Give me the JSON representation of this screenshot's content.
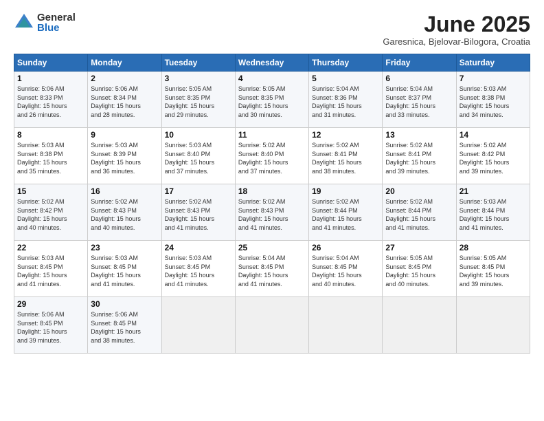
{
  "header": {
    "logo_general": "General",
    "logo_blue": "Blue",
    "month_title": "June 2025",
    "location": "Garesnica, Bjelovar-Bilogora, Croatia"
  },
  "weekdays": [
    "Sunday",
    "Monday",
    "Tuesday",
    "Wednesday",
    "Thursday",
    "Friday",
    "Saturday"
  ],
  "weeks": [
    [
      {
        "day": "1",
        "info": "Sunrise: 5:06 AM\nSunset: 8:33 PM\nDaylight: 15 hours\nand 26 minutes."
      },
      {
        "day": "2",
        "info": "Sunrise: 5:06 AM\nSunset: 8:34 PM\nDaylight: 15 hours\nand 28 minutes."
      },
      {
        "day": "3",
        "info": "Sunrise: 5:05 AM\nSunset: 8:35 PM\nDaylight: 15 hours\nand 29 minutes."
      },
      {
        "day": "4",
        "info": "Sunrise: 5:05 AM\nSunset: 8:35 PM\nDaylight: 15 hours\nand 30 minutes."
      },
      {
        "day": "5",
        "info": "Sunrise: 5:04 AM\nSunset: 8:36 PM\nDaylight: 15 hours\nand 31 minutes."
      },
      {
        "day": "6",
        "info": "Sunrise: 5:04 AM\nSunset: 8:37 PM\nDaylight: 15 hours\nand 33 minutes."
      },
      {
        "day": "7",
        "info": "Sunrise: 5:03 AM\nSunset: 8:38 PM\nDaylight: 15 hours\nand 34 minutes."
      }
    ],
    [
      {
        "day": "8",
        "info": "Sunrise: 5:03 AM\nSunset: 8:38 PM\nDaylight: 15 hours\nand 35 minutes."
      },
      {
        "day": "9",
        "info": "Sunrise: 5:03 AM\nSunset: 8:39 PM\nDaylight: 15 hours\nand 36 minutes."
      },
      {
        "day": "10",
        "info": "Sunrise: 5:03 AM\nSunset: 8:40 PM\nDaylight: 15 hours\nand 37 minutes."
      },
      {
        "day": "11",
        "info": "Sunrise: 5:02 AM\nSunset: 8:40 PM\nDaylight: 15 hours\nand 37 minutes."
      },
      {
        "day": "12",
        "info": "Sunrise: 5:02 AM\nSunset: 8:41 PM\nDaylight: 15 hours\nand 38 minutes."
      },
      {
        "day": "13",
        "info": "Sunrise: 5:02 AM\nSunset: 8:41 PM\nDaylight: 15 hours\nand 39 minutes."
      },
      {
        "day": "14",
        "info": "Sunrise: 5:02 AM\nSunset: 8:42 PM\nDaylight: 15 hours\nand 39 minutes."
      }
    ],
    [
      {
        "day": "15",
        "info": "Sunrise: 5:02 AM\nSunset: 8:42 PM\nDaylight: 15 hours\nand 40 minutes."
      },
      {
        "day": "16",
        "info": "Sunrise: 5:02 AM\nSunset: 8:43 PM\nDaylight: 15 hours\nand 40 minutes."
      },
      {
        "day": "17",
        "info": "Sunrise: 5:02 AM\nSunset: 8:43 PM\nDaylight: 15 hours\nand 41 minutes."
      },
      {
        "day": "18",
        "info": "Sunrise: 5:02 AM\nSunset: 8:43 PM\nDaylight: 15 hours\nand 41 minutes."
      },
      {
        "day": "19",
        "info": "Sunrise: 5:02 AM\nSunset: 8:44 PM\nDaylight: 15 hours\nand 41 minutes."
      },
      {
        "day": "20",
        "info": "Sunrise: 5:02 AM\nSunset: 8:44 PM\nDaylight: 15 hours\nand 41 minutes."
      },
      {
        "day": "21",
        "info": "Sunrise: 5:03 AM\nSunset: 8:44 PM\nDaylight: 15 hours\nand 41 minutes."
      }
    ],
    [
      {
        "day": "22",
        "info": "Sunrise: 5:03 AM\nSunset: 8:45 PM\nDaylight: 15 hours\nand 41 minutes."
      },
      {
        "day": "23",
        "info": "Sunrise: 5:03 AM\nSunset: 8:45 PM\nDaylight: 15 hours\nand 41 minutes."
      },
      {
        "day": "24",
        "info": "Sunrise: 5:03 AM\nSunset: 8:45 PM\nDaylight: 15 hours\nand 41 minutes."
      },
      {
        "day": "25",
        "info": "Sunrise: 5:04 AM\nSunset: 8:45 PM\nDaylight: 15 hours\nand 41 minutes."
      },
      {
        "day": "26",
        "info": "Sunrise: 5:04 AM\nSunset: 8:45 PM\nDaylight: 15 hours\nand 40 minutes."
      },
      {
        "day": "27",
        "info": "Sunrise: 5:05 AM\nSunset: 8:45 PM\nDaylight: 15 hours\nand 40 minutes."
      },
      {
        "day": "28",
        "info": "Sunrise: 5:05 AM\nSunset: 8:45 PM\nDaylight: 15 hours\nand 39 minutes."
      }
    ],
    [
      {
        "day": "29",
        "info": "Sunrise: 5:06 AM\nSunset: 8:45 PM\nDaylight: 15 hours\nand 39 minutes."
      },
      {
        "day": "30",
        "info": "Sunrise: 5:06 AM\nSunset: 8:45 PM\nDaylight: 15 hours\nand 38 minutes."
      },
      {
        "day": "",
        "info": ""
      },
      {
        "day": "",
        "info": ""
      },
      {
        "day": "",
        "info": ""
      },
      {
        "day": "",
        "info": ""
      },
      {
        "day": "",
        "info": ""
      }
    ]
  ]
}
